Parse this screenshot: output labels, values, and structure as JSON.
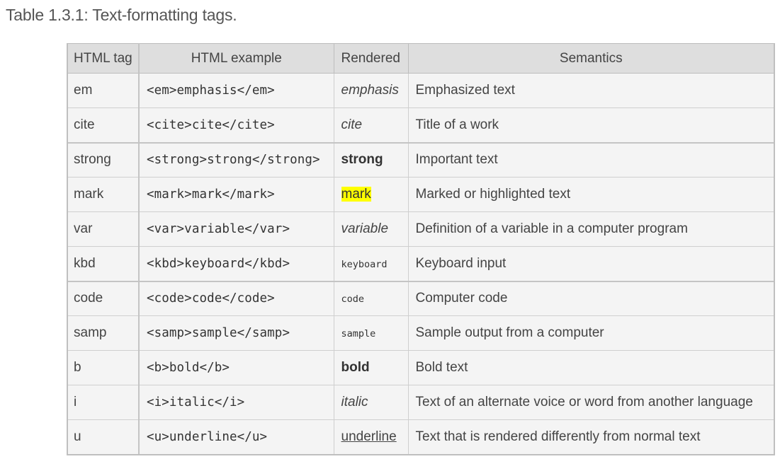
{
  "caption": "Table 1.3.1: Text-formatting tags.",
  "headers": [
    "HTML tag",
    "HTML example",
    "Rendered",
    "Semantics"
  ],
  "rows": [
    {
      "tag": "em",
      "example": "<em>emphasis</em>",
      "rendered": "emphasis",
      "style": "italic",
      "semantics": "Emphasized text"
    },
    {
      "tag": "cite",
      "example": "<cite>cite</cite>",
      "rendered": "cite",
      "style": "italic",
      "semantics": "Title of a work"
    },
    {
      "tag": "strong",
      "example": "<strong>strong</strong>",
      "rendered": "strong",
      "style": "bold",
      "semantics": "Important text"
    },
    {
      "tag": "mark",
      "example": "<mark>mark</mark>",
      "rendered": "mark",
      "style": "mark",
      "semantics": "Marked or highlighted text"
    },
    {
      "tag": "var",
      "example": "<var>variable</var>",
      "rendered": "variable",
      "style": "italic",
      "semantics": "Definition of a variable in a computer program"
    },
    {
      "tag": "kbd",
      "example": "<kbd>keyboard</kbd>",
      "rendered": "keyboard",
      "style": "mono-small",
      "semantics": "Keyboard input"
    },
    {
      "tag": "code",
      "example": "<code>code</code>",
      "rendered": "code",
      "style": "mono-small",
      "semantics": "Computer code"
    },
    {
      "tag": "samp",
      "example": "<samp>sample</samp>",
      "rendered": "sample",
      "style": "mono-small",
      "semantics": "Sample output from a computer"
    },
    {
      "tag": "b",
      "example": "<b>bold</b>",
      "rendered": "bold",
      "style": "bold",
      "semantics": "Bold text"
    },
    {
      "tag": "i",
      "example": "<i>italic</i>",
      "rendered": "italic",
      "style": "italic",
      "semantics": "Text of an alternate voice or word from another language"
    },
    {
      "tag": "u",
      "example": "<u>underline</u>",
      "rendered": "underline",
      "style": "underline",
      "semantics": "Text that is rendered differently from normal text"
    }
  ],
  "colors": {
    "highlight": "#ffff00",
    "header_bg": "#dedede",
    "cell_bg": "#f4f4f4"
  }
}
